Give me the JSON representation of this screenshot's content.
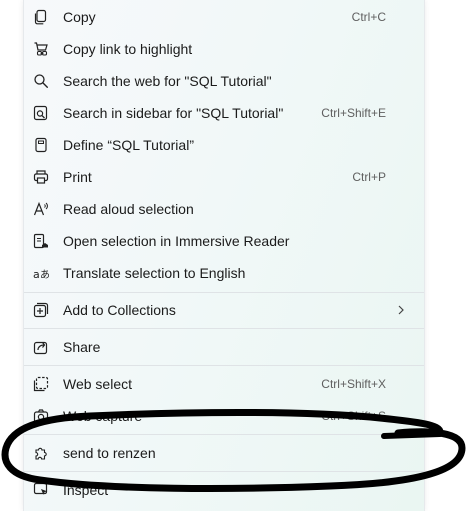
{
  "menu": {
    "items": [
      {
        "label": "Copy",
        "shortcut": "Ctrl+C",
        "icon": "copy-icon"
      },
      {
        "label": "Copy link to highlight",
        "shortcut": "",
        "icon": "link-highlight-icon"
      },
      {
        "label": "Search the web for \"SQL Tutorial\"",
        "shortcut": "",
        "icon": "search-icon"
      },
      {
        "label": "Search in sidebar for \"SQL Tutorial\"",
        "shortcut": "Ctrl+Shift+E",
        "icon": "sidebar-search-icon"
      },
      {
        "label": "Define “SQL Tutorial”",
        "shortcut": "",
        "icon": "book-icon"
      },
      {
        "label": "Print",
        "shortcut": "Ctrl+P",
        "icon": "printer-icon"
      },
      {
        "label": "Read aloud selection",
        "shortcut": "",
        "icon": "read-aloud-icon"
      },
      {
        "label": "Open selection in Immersive Reader",
        "shortcut": "",
        "icon": "immersive-reader-icon"
      },
      {
        "label": "Translate selection to English",
        "shortcut": "",
        "icon": "translate-icon"
      },
      {
        "label": "Add to Collections",
        "shortcut": "",
        "icon": "collections-icon",
        "submenu": true
      },
      {
        "label": "Share",
        "shortcut": "",
        "icon": "share-icon"
      },
      {
        "label": "Web select",
        "shortcut": "Ctrl+Shift+X",
        "icon": "web-select-icon"
      },
      {
        "label": "Web capture",
        "shortcut": "Ctrl+Shift+S",
        "icon": "camera-icon"
      },
      {
        "label": "send to renzen",
        "shortcut": "",
        "icon": "puzzle-icon"
      },
      {
        "label": "Inspect",
        "shortcut": "",
        "icon": "inspect-icon"
      }
    ]
  },
  "colors": {
    "text": "#1b1b1b",
    "shortcut": "#5f5f5f",
    "annotation": "#000000"
  }
}
